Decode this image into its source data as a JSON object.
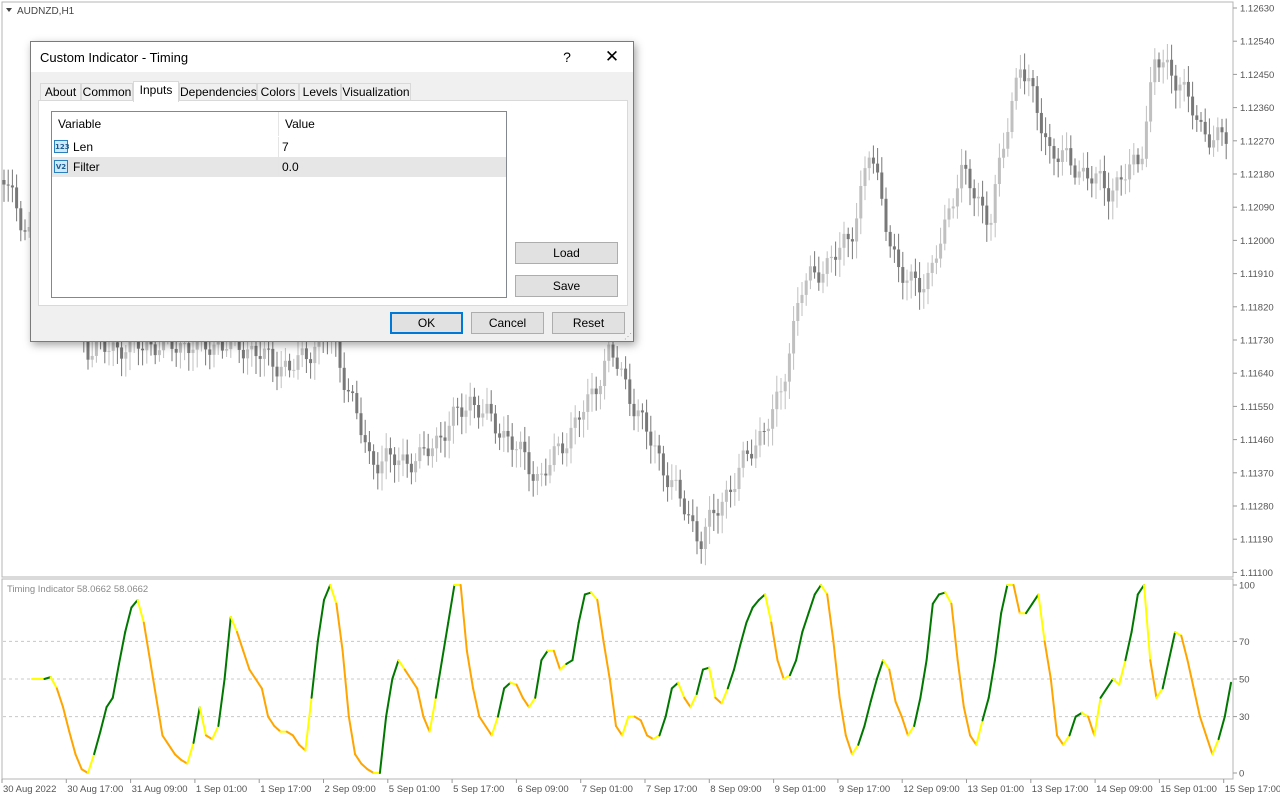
{
  "chart": {
    "symbol_label": "AUDNZD,H1",
    "price_ticks": [
      "1.12630",
      "1.12540",
      "1.12450",
      "1.12360",
      "1.12270",
      "1.12180",
      "1.12090",
      "1.12000",
      "1.11910",
      "1.11820",
      "1.11730",
      "1.11640",
      "1.11550",
      "1.11460",
      "1.11370",
      "1.11280",
      "1.11190",
      "1.11100"
    ],
    "time_labels": [
      "30 Aug 2022",
      "30 Aug 17:00",
      "31 Aug 09:00",
      "1 Sep 01:00",
      "1 Sep 17:00",
      "2 Sep 09:00",
      "5 Sep 01:00",
      "5 Sep 17:00",
      "6 Sep 09:00",
      "7 Sep 01:00",
      "7 Sep 17:00",
      "8 Sep 09:00",
      "9 Sep 01:00",
      "9 Sep 17:00",
      "12 Sep 09:00",
      "13 Sep 01:00",
      "13 Sep 17:00",
      "14 Sep 09:00",
      "15 Sep 01:00",
      "15 Sep 17:00"
    ],
    "candle_colors": {
      "bull": "#c0c0c0",
      "bear": "#787878"
    },
    "indicator": {
      "label": "Timing Indicator 58.0662 58.0662",
      "levels": [
        "100",
        "70",
        "50",
        "30",
        "0"
      ],
      "level_values": [
        100,
        70,
        50,
        30,
        0
      ],
      "colors": {
        "up": "#007800",
        "down": "#ffa500",
        "turn": "#ffff00"
      }
    }
  },
  "chart_data": {
    "type": "line",
    "title": "Timing Indicator 58.0662 58.0662",
    "ylim": [
      0,
      100
    ],
    "y_ticks": [
      0,
      30,
      50,
      70,
      100
    ],
    "x_tick_labels": [
      "30 Aug 2022",
      "30 Aug 17:00",
      "31 Aug 09:00",
      "1 Sep 01:00",
      "1 Sep 17:00",
      "2 Sep 09:00",
      "5 Sep 01:00",
      "5 Sep 17:00",
      "6 Sep 09:00",
      "7 Sep 01:00",
      "7 Sep 17:00",
      "8 Sep 09:00",
      "9 Sep 01:00",
      "9 Sep 17:00",
      "12 Sep 09:00",
      "13 Sep 01:00",
      "13 Sep 17:00",
      "14 Sep 09:00",
      "15 Sep 01:00",
      "15 Sep 17:00"
    ],
    "series": [
      {
        "values": [
          50,
          50,
          50,
          51,
          45,
          35,
          22,
          10,
          2,
          0,
          10,
          22,
          35,
          40,
          58,
          75,
          88,
          92,
          80,
          60,
          40,
          20,
          15,
          10,
          7,
          5,
          16,
          35,
          20,
          18,
          25,
          50,
          83,
          75,
          65,
          55,
          50,
          45,
          30,
          25,
          22,
          22,
          20,
          15,
          12,
          40,
          70,
          92,
          100,
          90,
          65,
          30,
          10,
          5,
          2,
          0,
          0,
          30,
          50,
          60,
          55,
          50,
          45,
          30,
          22,
          40,
          60,
          80,
          100,
          100,
          65,
          45,
          30,
          25,
          20,
          30,
          45,
          48,
          47,
          40,
          35,
          40,
          60,
          65,
          65,
          55,
          58,
          60,
          80,
          95,
          96,
          92,
          70,
          50,
          25,
          20,
          30,
          30,
          28,
          20,
          18,
          20,
          30,
          45,
          48,
          40,
          35,
          42,
          55,
          56,
          40,
          37,
          45,
          55,
          68,
          80,
          88,
          92,
          95,
          80,
          60,
          50,
          52,
          60,
          75,
          85,
          95,
          100,
          95,
          70,
          40,
          20,
          10,
          15,
          25,
          38,
          50,
          60,
          55,
          38,
          30,
          20,
          25,
          40,
          60,
          90,
          95,
          96,
          90,
          60,
          35,
          20,
          15,
          28,
          40,
          60,
          85,
          100,
          100,
          85,
          85,
          90,
          95,
          70,
          50,
          20,
          15,
          20,
          30,
          32,
          30,
          20,
          40,
          45,
          50,
          47,
          60,
          75,
          95,
          100,
          60,
          40,
          45,
          60,
          75,
          73,
          60,
          45,
          30,
          20,
          10,
          18,
          30,
          48
        ]
      }
    ]
  },
  "dialog": {
    "title": "Custom Indicator - Timing",
    "help": "?",
    "close": "✕",
    "tabs": [
      "About",
      "Common",
      "Inputs",
      "Dependencies",
      "Colors",
      "Levels",
      "Visualization"
    ],
    "active_tab": "Inputs",
    "table": {
      "headers": [
        "Variable",
        "Value"
      ],
      "rows": [
        {
          "icon": "123",
          "icon_name": "integer-icon",
          "name": "Len",
          "value": "7"
        },
        {
          "icon": "V2",
          "icon_name": "double-icon",
          "name": "Filter",
          "value": "0.0"
        }
      ]
    },
    "buttons": {
      "load": "Load",
      "save": "Save",
      "ok": "OK",
      "cancel": "Cancel",
      "reset": "Reset"
    }
  }
}
